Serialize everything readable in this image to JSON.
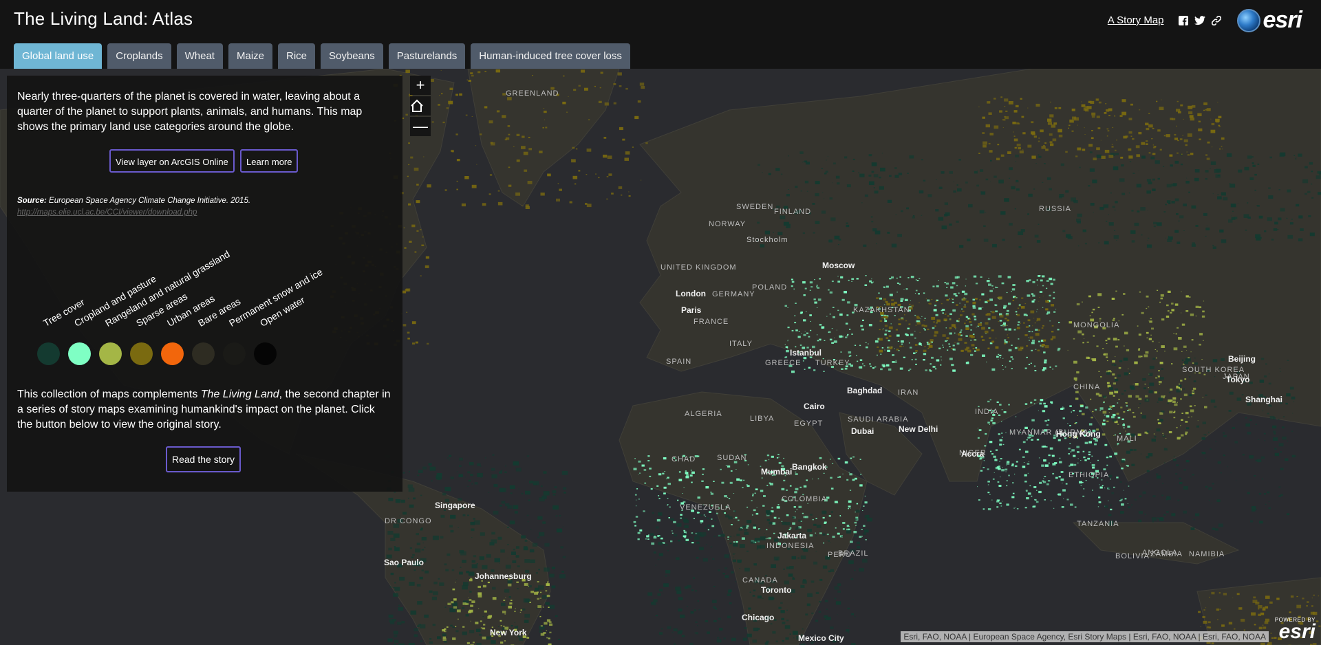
{
  "header": {
    "title": "The Living Land: Atlas",
    "story_map_link": "A Story Map",
    "social_icons": [
      "facebook-icon",
      "twitter-icon",
      "link-icon"
    ],
    "brand_logo": "esri"
  },
  "tabs": [
    {
      "label": "Global land use",
      "active": true
    },
    {
      "label": "Croplands",
      "active": false
    },
    {
      "label": "Wheat",
      "active": false
    },
    {
      "label": "Maize",
      "active": false
    },
    {
      "label": "Rice",
      "active": false
    },
    {
      "label": "Soybeans",
      "active": false
    },
    {
      "label": "Pasturelands",
      "active": false
    },
    {
      "label": "Human-induced tree cover loss",
      "active": false
    }
  ],
  "panel": {
    "intro": "Nearly three-quarters of the planet is covered in water, leaving about a quarter of the planet to support plants, animals, and humans. This map shows the primary land use categories around the globe.",
    "view_layer_button": "View layer on ArcGIS Online",
    "learn_more_button": "Learn more",
    "source_label": "Source:",
    "source_text": "European Space Agency Climate Change Initiative. 2015.",
    "source_url": "http://maps.elie.ucl.ac.be/CCI/viewer/download.php",
    "legend": [
      {
        "label": "Tree cover",
        "color": "#143a30"
      },
      {
        "label": "Cropland and pasture",
        "color": "#7fffc4"
      },
      {
        "label": "Rangeland and natural grassland",
        "color": "#a4b646"
      },
      {
        "label": "Sparse areas",
        "color": "#7a6a10"
      },
      {
        "label": "Urban areas",
        "color": "#f2660c"
      },
      {
        "label": "Bare areas",
        "color": "#2e2c22"
      },
      {
        "label": "Permanent snow and ice",
        "color": "#1a1a17"
      },
      {
        "label": "Open water",
        "color": "#050505"
      }
    ],
    "collection_before": "This collection of maps complements ",
    "collection_italic": "The Living Land",
    "collection_after": ", the second chapter in a series of story maps examining humankind's impact on the planet. Click the button below to view the original story.",
    "read_story_button": "Read the story"
  },
  "map": {
    "zoom_in": "+",
    "zoom_out": "—",
    "home_icon": "home-icon",
    "attribution": "Esri, FAO, NOAA | European Space Agency, Esri Story Maps | Esri, FAO, NOAA | Esri, FAO, NOAA",
    "powered_by_small": "POWERED BY",
    "powered_by_big": "esri",
    "labels": [
      {
        "text": "GREENLAND",
        "type": "country"
      },
      {
        "text": "SWEDEN",
        "type": "country"
      },
      {
        "text": "FINLAND",
        "type": "country"
      },
      {
        "text": "NORWAY",
        "type": "country"
      },
      {
        "text": "RUSSIA",
        "type": "country"
      },
      {
        "text": "Stockholm",
        "type": "small"
      },
      {
        "text": "UNITED KINGDOM",
        "type": "country"
      },
      {
        "text": "Moscow",
        "type": "city"
      },
      {
        "text": "London",
        "type": "city"
      },
      {
        "text": "GERMANY",
        "type": "country"
      },
      {
        "text": "POLAND",
        "type": "country"
      },
      {
        "text": "Paris",
        "type": "city"
      },
      {
        "text": "FRANCE",
        "type": "country"
      },
      {
        "text": "KAZAKHSTAN",
        "type": "country"
      },
      {
        "text": "MONGOLIA",
        "type": "country"
      },
      {
        "text": "ITALY",
        "type": "country"
      },
      {
        "text": "SPAIN",
        "type": "country"
      },
      {
        "text": "GREECE",
        "type": "country"
      },
      {
        "text": "Istanbul",
        "type": "city"
      },
      {
        "text": "TURKEY",
        "type": "country"
      },
      {
        "text": "Beijing",
        "type": "city"
      },
      {
        "text": "SOUTH KOREA",
        "type": "country"
      },
      {
        "text": "JAPAN",
        "type": "country"
      },
      {
        "text": "Tokyo",
        "type": "city"
      },
      {
        "text": "Baghdad",
        "type": "city"
      },
      {
        "text": "IRAN",
        "type": "country"
      },
      {
        "text": "CHINA",
        "type": "country"
      },
      {
        "text": "Shanghai",
        "type": "city"
      },
      {
        "text": "ALGERIA",
        "type": "country"
      },
      {
        "text": "LIBYA",
        "type": "country"
      },
      {
        "text": "Cairo",
        "type": "city"
      },
      {
        "text": "EGYPT",
        "type": "country"
      },
      {
        "text": "SAUDI ARABIA",
        "type": "country"
      },
      {
        "text": "Dubai",
        "type": "city"
      },
      {
        "text": "New Delhi",
        "type": "city"
      },
      {
        "text": "INDIA",
        "type": "country"
      },
      {
        "text": "MYANMAR (BURMA)",
        "type": "country"
      },
      {
        "text": "Hong Kong",
        "type": "city"
      },
      {
        "text": "MALI",
        "type": "country"
      },
      {
        "text": "NIGER",
        "type": "country"
      },
      {
        "text": "CHAD",
        "type": "country"
      },
      {
        "text": "SUDAN",
        "type": "country"
      },
      {
        "text": "Mumbai",
        "type": "city"
      },
      {
        "text": "Bangkok",
        "type": "city"
      },
      {
        "text": "Accra",
        "type": "city"
      },
      {
        "text": "ETHIOPIA",
        "type": "country"
      },
      {
        "text": "VENEZUELA",
        "type": "country"
      },
      {
        "text": "COLOMBIA",
        "type": "country"
      },
      {
        "text": "Singapore",
        "type": "city"
      },
      {
        "text": "DR CONGO",
        "type": "country"
      },
      {
        "text": "TANZANIA",
        "type": "country"
      },
      {
        "text": "Jakarta",
        "type": "city"
      },
      {
        "text": "INDONESIA",
        "type": "country"
      },
      {
        "text": "PERU",
        "type": "country"
      },
      {
        "text": "BRAZIL",
        "type": "country"
      },
      {
        "text": "BOLIVIA",
        "type": "country"
      },
      {
        "text": "ANGOLA",
        "type": "country"
      },
      {
        "text": "ZAMBIA",
        "type": "country"
      },
      {
        "text": "NAMIBIA",
        "type": "country"
      },
      {
        "text": "Sao Paulo",
        "type": "city"
      },
      {
        "text": "Johannesburg",
        "type": "city"
      },
      {
        "text": "CANADA",
        "type": "country"
      },
      {
        "text": "Toronto",
        "type": "city"
      },
      {
        "text": "Chicago",
        "type": "city"
      },
      {
        "text": "New York",
        "type": "city"
      },
      {
        "text": "Mexico City",
        "type": "city"
      }
    ]
  }
}
